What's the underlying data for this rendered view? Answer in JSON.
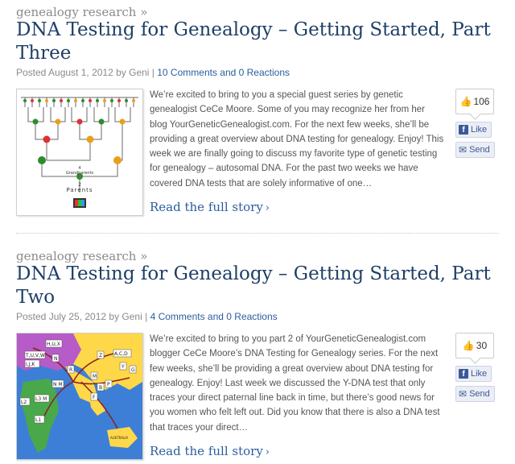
{
  "posts": [
    {
      "category": "genealogy research »",
      "title": "DNA Testing for Genealogy – Getting Started, Part Three",
      "meta": {
        "posted": "Posted August 1, 2012 by Geni | ",
        "comments": "10 Comments and 0 Reactions"
      },
      "excerpt": "We’re excited to bring to you a special guest series by genetic genealogist CeCe Moore. Some of you may recognize her from her blog YourGeneticGenealogist.com. For the next few weeks, she’ll be providing a great overview about DNA testing for genealogy. Enjoy! This week we are finally going to discuss my favorite type of genetic testing for genealogy – autosomal DNA. For the past two weeks we have covered DNA tests that are solely informative of one…",
      "read_more": "Read the full story",
      "likes": "106",
      "like_label": "Like",
      "send_label": "Send",
      "thumb": {
        "label_grandparents": "Grandparents",
        "label_parents": "Parents",
        "label_2": "2",
        "label_4": "4"
      }
    },
    {
      "category": "genealogy research »",
      "title": "DNA Testing for Genealogy – Getting Started, Part Two",
      "meta": {
        "posted": "Posted July 25, 2012 by Geni | ",
        "comments": "4 Comments and 0 Reactions"
      },
      "excerpt": "We’re excited to bring to you part 2 of YourGeneticGenealogist.com blogger CeCe Moore’s DNA Testing for Genealogy series. For the next few weeks, she’ll be providing a great overview about DNA testing for genealogy. Enjoy! Last week we discussed the Y-DNA test that only traces your direct paternal line back in time, but there’s good news for you women who felt left out. Did you know that there is also a DNA test that traces your direct…",
      "read_more": "Read the full story",
      "likes": "30",
      "like_label": "Like",
      "send_label": "Send",
      "thumb": {
        "labels": [
          "H,U,X",
          "T,U,V,W",
          "I,J,K",
          "N",
          "R",
          "A,C,D",
          "Z",
          "M",
          "G",
          "Y",
          "B",
          "F",
          "L2",
          "L3 M",
          "L1",
          "N M",
          "P",
          "AUSTRALIA"
        ]
      }
    }
  ],
  "colors": {
    "title": "#1f3f67",
    "link": "#2a5d9f",
    "meta": "#8a8a8a",
    "facebook": "#3b5998"
  }
}
